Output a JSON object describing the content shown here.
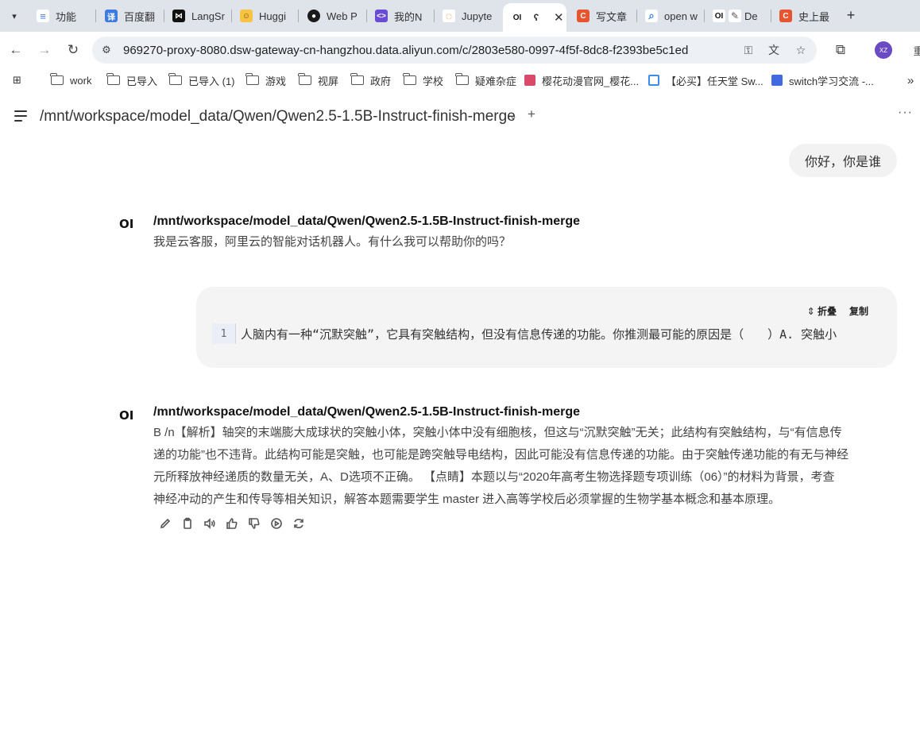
{
  "tabs": [
    {
      "title": "功能",
      "icon": "notes-icon",
      "color": "#4a7bd0"
    },
    {
      "title": "百度翻",
      "icon": "translate-icon",
      "color": "#3c7be0"
    },
    {
      "title": "LangSr",
      "icon": "langsmith-icon",
      "color": "#111111"
    },
    {
      "title": "Huggi",
      "icon": "huggingface-icon",
      "color": "#f6c343"
    },
    {
      "title": "Web P",
      "icon": "github-icon",
      "color": "#1a1a1a"
    },
    {
      "title": "我的N",
      "icon": "code-icon",
      "color": "#6a4bd6"
    },
    {
      "title": "Jupyte",
      "icon": "jupyter-icon",
      "color": "#f07a2e"
    },
    {
      "title": "OI",
      "icon": "openwebui-icon",
      "color": "#111111",
      "active": true
    },
    {
      "title": "写文章",
      "icon": "csdn-icon",
      "color": "#e8542f"
    },
    {
      "title": "open w",
      "icon": "search-icon",
      "color": "#3c7be0"
    },
    {
      "title": "De",
      "icon": "openwebui-icon",
      "color": "#111111"
    },
    {
      "title": "史上最",
      "icon": "csdn-icon",
      "color": "#e8542f"
    }
  ],
  "address_bar": {
    "url": "969270-proxy-8080.dsw-gateway-cn-hangzhou.data.aliyun.com/c/2803e580-0997-4f5f-8dc8-f2393be5c1ed"
  },
  "profile": {
    "initials": "XZ",
    "overflow": "重"
  },
  "bookmarks": [
    {
      "label": "work",
      "type": "folder"
    },
    {
      "label": "已导入",
      "type": "folder"
    },
    {
      "label": "已导入 (1)",
      "type": "folder"
    },
    {
      "label": "游戏",
      "type": "folder"
    },
    {
      "label": "视屏",
      "type": "folder"
    },
    {
      "label": "政府",
      "type": "folder"
    },
    {
      "label": "学校",
      "type": "folder"
    },
    {
      "label": "疑难杂症",
      "type": "folder"
    },
    {
      "label": "樱花动漫官网_樱花...",
      "type": "link",
      "color": "#d94a6a"
    },
    {
      "label": "【必买】任天堂 Sw...",
      "type": "link",
      "color": "#3a8ee6"
    },
    {
      "label": "switch学习交流 -...",
      "type": "link",
      "color": "#4169e1"
    }
  ],
  "header": {
    "model_name": "/mnt/workspace/model_data/Qwen/Qwen2.5-1.5B-Instruct-finish-merge",
    "chevron": "⌄",
    "plus": "+",
    "more": "···"
  },
  "logo_text": "OI",
  "messages": {
    "user1": "你好，你是谁",
    "ai1_name": "/mnt/workspace/model_data/Qwen/Qwen2.5-1.5B-Instruct-finish-merge",
    "ai1_text": "我是云客服，阿里云的智能对话机器人。有什么我可以帮助你的吗？",
    "code": {
      "collapse_label": "折叠",
      "copy_label": "复制",
      "line_number": "1",
      "text": "人脑内有一种“沉默突触”，它具有突触结构，但没有信息传递的功能。你推测最可能的原因是（　　）A. 突触小"
    },
    "ai2_name": "/mnt/workspace/model_data/Qwen/Qwen2.5-1.5B-Instruct-finish-merge",
    "ai2_lines": [
      "B /n【解析】轴突的末端膨大成球状的突触小体，突触小体中没有细胞核，但这与“沉默突触”无关；此结构有突触结构，与“有信息传",
      "递的功能”也不违背。此结构可能是突触，也可能是跨突触导电结构，因此可能没有信息传递的功能。由于突触传递功能的有无与神经",
      "元所释放神经递质的数量无关，A、D选项不正确。 【点睛】本题以与“2020年高考生物选择题专项训练（06）”的材料为背景，考查",
      "神经冲动的产生和传导等相关知识，解答本题需要学生 master 进入高等学校后必须掌握的生物学基本概念和基本原理。"
    ]
  }
}
